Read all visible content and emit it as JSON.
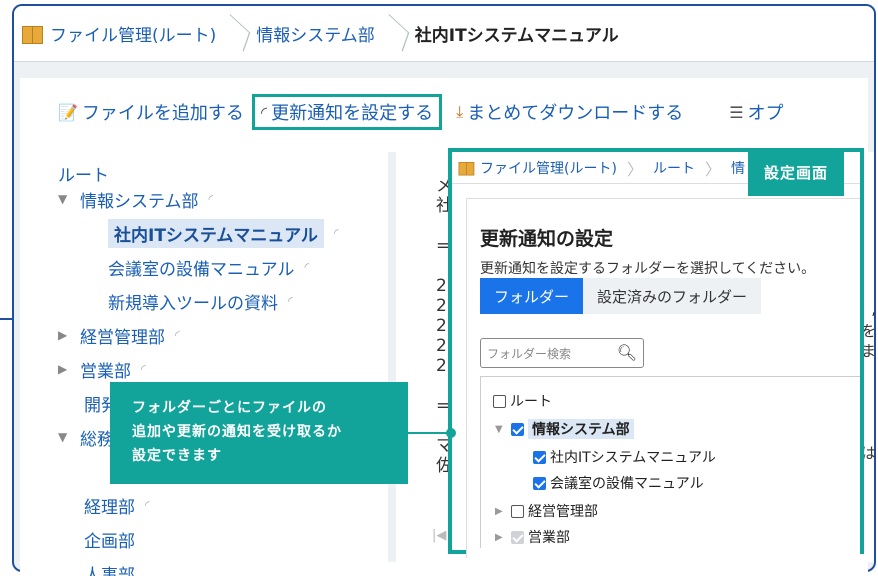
{
  "breadcrumb": {
    "items": [
      "ファイル管理(ルート)",
      "情報システム部",
      "社内ITシステムマニュアル"
    ]
  },
  "toolbar": {
    "add_file": "ファイルを追加する",
    "set_notification": "更新通知を設定する",
    "bulk_download": "まとめてダウンロードする",
    "options": "オプ"
  },
  "tree": {
    "root": "ルート",
    "items": [
      {
        "label": "情報システム部"
      },
      {
        "label": "社内ITシステムマニュアル"
      },
      {
        "label": "会議室の設備マニュアル"
      },
      {
        "label": "新規導入ツールの資料"
      },
      {
        "label": "経営管理部"
      },
      {
        "label": "営業部"
      },
      {
        "label": "開発"
      },
      {
        "label": "総務"
      },
      {
        "label": "経理部"
      },
      {
        "label": "企画部"
      },
      {
        "label": "人事部"
      }
    ]
  },
  "content": {
    "lines": [
      "メ",
      "社",
      "",
      "=",
      "",
      "2",
      "2",
      "2",
      "2",
      "2",
      "",
      "=",
      "",
      "マ",
      "佐"
    ],
    "right_lines": [
      ",",
      "を",
      "ま",
      "は"
    ]
  },
  "modal": {
    "breadcrumb": [
      "ファイル管理(ルート)",
      "ルート",
      "情"
    ],
    "title": "更新通知の設定",
    "description": "更新通知を設定するフォルダーを選択してください。",
    "tab_folder": "フォルダー",
    "tab_configured": "設定済みのフォルダー",
    "search_placeholder": "フォルダー検索",
    "folders": [
      {
        "label": "ルート",
        "checked": false
      },
      {
        "label": "情報システム部",
        "checked": true
      },
      {
        "label": "社内ITシステムマニュアル",
        "checked": true
      },
      {
        "label": "会議室の設備マニュアル",
        "checked": true
      },
      {
        "label": "経営管理部",
        "checked": false
      },
      {
        "label": "営業部",
        "checked": true
      }
    ]
  },
  "annotation": {
    "settings_label": "設定画面",
    "callout_line1": "フォルダーごとにファイルの",
    "callout_line2": "追加や更新の通知を受け取るか",
    "callout_line3": "設定できます"
  },
  "colors": {
    "accent": "#12a39a",
    "link": "#1a5fb4",
    "primary_button": "#1a73e8",
    "frame": "#1f4f9e"
  }
}
